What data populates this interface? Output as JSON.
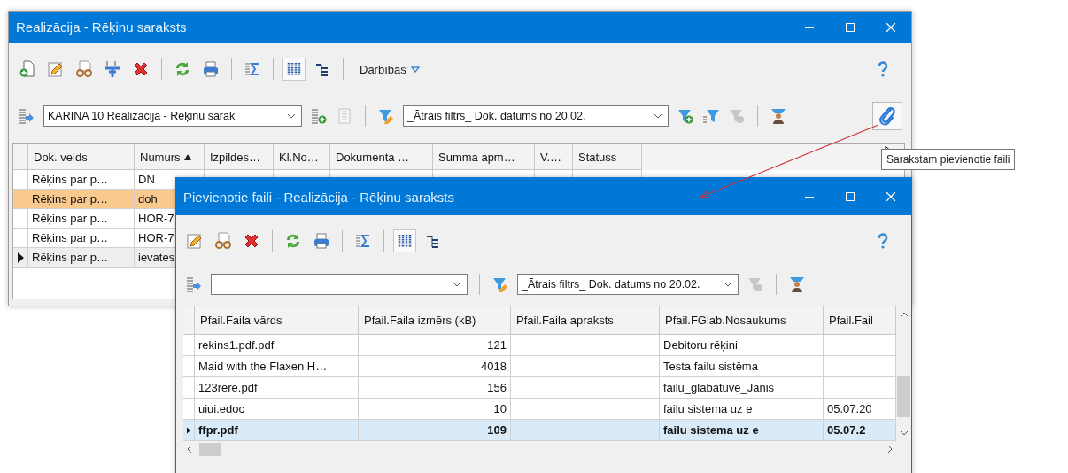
{
  "windows": [
    {
      "title": "Realizācija - Rēķinu saraksts",
      "toolbar": [
        [
          {
            "kind": "new",
            "pressed": false
          },
          {
            "kind": "edit",
            "pressed": false
          },
          {
            "kind": "view",
            "pressed": false
          },
          {
            "kind": "split",
            "pressed": false
          },
          {
            "kind": "delete",
            "pressed": false
          }
        ],
        [
          {
            "kind": "refresh",
            "pressed": false
          },
          {
            "kind": "print",
            "pressed": false
          }
        ],
        [
          {
            "kind": "sum",
            "pressed": false
          }
        ],
        [
          {
            "kind": "columns",
            "pressed": true
          },
          {
            "kind": "tree",
            "pressed": false
          }
        ]
      ],
      "menu": "Darbības",
      "layout": {
        "value": "KARINA 10 Realizācija - Rēķinu sarak"
      },
      "layout_tools": [
        {
          "kind": "layout-add",
          "disabled": false
        },
        {
          "kind": "layout-list",
          "disabled": true
        }
      ],
      "filter": {
        "value": "_Ātrais filtrs_ Dok. datums no 20.02."
      },
      "filter_tools": [
        {
          "kind": "filter-add",
          "disabled": false
        },
        {
          "kind": "filter-list",
          "disabled": false
        },
        {
          "kind": "filter-clear",
          "disabled": true
        }
      ],
      "extra_tools": [
        {
          "kind": "user-filter",
          "disabled": false
        }
      ],
      "side_tool": {
        "kind": "attach",
        "hovered": true
      },
      "table": {
        "columns": [
          {
            "label": "Dok. veids",
            "sorted": false
          },
          {
            "label": "Numurs",
            "sorted": true
          },
          {
            "label": "Izpildes…",
            "sorted": false
          },
          {
            "label": "Kl.No…",
            "sorted": false
          },
          {
            "label": "Dokumenta …",
            "sorted": false
          },
          {
            "label": "Summa apm…",
            "sorted": false
          },
          {
            "label": "V.…",
            "sorted": false
          },
          {
            "label": "Statuss",
            "sorted": false
          }
        ],
        "rows": [
          {
            "cells": [
              "Rēķins par p…",
              "DN"
            ],
            "selected": false,
            "current": false
          },
          {
            "cells": [
              "Rēķins par p…",
              "doh"
            ],
            "selected": true,
            "current": false
          },
          {
            "cells": [
              "Rēķins par p…",
              "HOR-7"
            ],
            "selected": false,
            "current": false
          },
          {
            "cells": [
              "Rēķins par p…",
              "HOR-7"
            ],
            "selected": false,
            "current": false
          },
          {
            "cells": [
              "Rēķins par p…",
              "ievates"
            ],
            "selected": false,
            "current": true
          }
        ]
      }
    },
    {
      "title": "Pievienotie faili - Realizācija - Rēķinu saraksts",
      "toolbar": [
        [
          {
            "kind": "edit",
            "pressed": false
          },
          {
            "kind": "view",
            "pressed": false
          },
          {
            "kind": "delete",
            "pressed": false
          }
        ],
        [
          {
            "kind": "refresh",
            "pressed": false
          },
          {
            "kind": "print",
            "pressed": false
          }
        ],
        [
          {
            "kind": "sum",
            "pressed": false
          }
        ],
        [
          {
            "kind": "columns",
            "pressed": true
          },
          {
            "kind": "tree",
            "pressed": false
          }
        ]
      ],
      "filter": {
        "value": "_Ātrais filtrs_ Dok. datums no 20.02."
      },
      "filter_tools": [
        {
          "kind": "filter-clear",
          "disabled": true
        }
      ],
      "extra_tools": [
        {
          "kind": "user-filter",
          "disabled": false
        }
      ],
      "table": {
        "columns": [
          {
            "label": "Pfail.Faila vārds",
            "sorted": false
          },
          {
            "label": "Pfail.Faila izmērs (kB)",
            "sorted": false
          },
          {
            "label": "Pfail.Faila apraksts",
            "sorted": false
          },
          {
            "label": "Pfail.FGlab.Nosaukums",
            "sorted": false
          },
          {
            "label": "Pfail.Fail",
            "sorted": false
          }
        ],
        "rows": [
          {
            "cells": [
              "rekins1.pdf.pdf",
              "121",
              null,
              "Debitoru rēķini"
            ],
            "selected": false,
            "current": false
          },
          {
            "cells": [
              "Maid with the Flaxen H…",
              "4018",
              null,
              "Testa failu sistēma"
            ],
            "selected": false,
            "current": false
          },
          {
            "cells": [
              "123rere.pdf",
              "156",
              null,
              "failu_glabatuve_Janis"
            ],
            "selected": false,
            "current": false
          },
          {
            "cells": [
              "uiui.edoc",
              "10",
              null,
              "failu sistema uz e",
              "05.07.20"
            ],
            "selected": false,
            "current": false
          },
          {
            "cells": [
              "ffpr.pdf",
              "109",
              null,
              "failu sistema uz e",
              "05.07.2"
            ],
            "selected": false,
            "current": true
          }
        ]
      }
    }
  ],
  "tooltip": "Sarakstam pievienotie faili"
}
